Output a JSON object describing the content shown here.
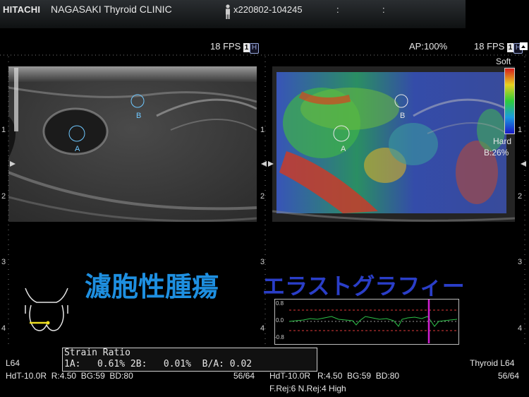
{
  "header": {
    "brand": "HITACHI",
    "clinic": "NAGASAKI Thyroid CLINIC",
    "patient_id": "x220802-104245",
    "sep1": ":",
    "sep2": ":"
  },
  "left_pane": {
    "fps": "18 FPS",
    "one": "1",
    "h": "H",
    "marker_a": "A",
    "marker_b": "B",
    "depth_marks": [
      "1",
      "2",
      "3",
      "4"
    ]
  },
  "right_pane": {
    "ap": "AP:100%",
    "fps": "18 FPS",
    "one": "1",
    "h": "H",
    "soft": "Soft",
    "hard": "Hard",
    "b_pct": "B:26%",
    "marker_a": "A",
    "marker_b": "B",
    "depth_marks": [
      "1",
      "2",
      "3",
      "4"
    ]
  },
  "overlay": {
    "title_blue": "濾胞性腫瘍",
    "title_purple": "エラストグラフィー"
  },
  "graph": {
    "y_top": "0.8",
    "y_mid": "0.0",
    "y_bot": "-0.8"
  },
  "strain": {
    "title": "Strain Ratio",
    "row": "1A:   0.61% 2B:   0.01%  B/A: 0.02"
  },
  "footer_left": {
    "probe": "L64",
    "params": "HdT-10.0R  R:4.50  BG:59  BD:80",
    "frame": "56/64"
  },
  "footer_right": {
    "preset": "Thyroid L64",
    "params": "HdT-10.0R   R:4.50  BG:59  BD:80",
    "frame": "56/64",
    "rej": "F.Rej:6 N.Rej:4  High"
  },
  "colors": {
    "title_blue": "#1e8fe0",
    "title_purple": "#2a3ec8",
    "graph_line": "#2ec24a",
    "graph_threshold": "#e03a3a",
    "graph_cursor": "#d020d0"
  }
}
